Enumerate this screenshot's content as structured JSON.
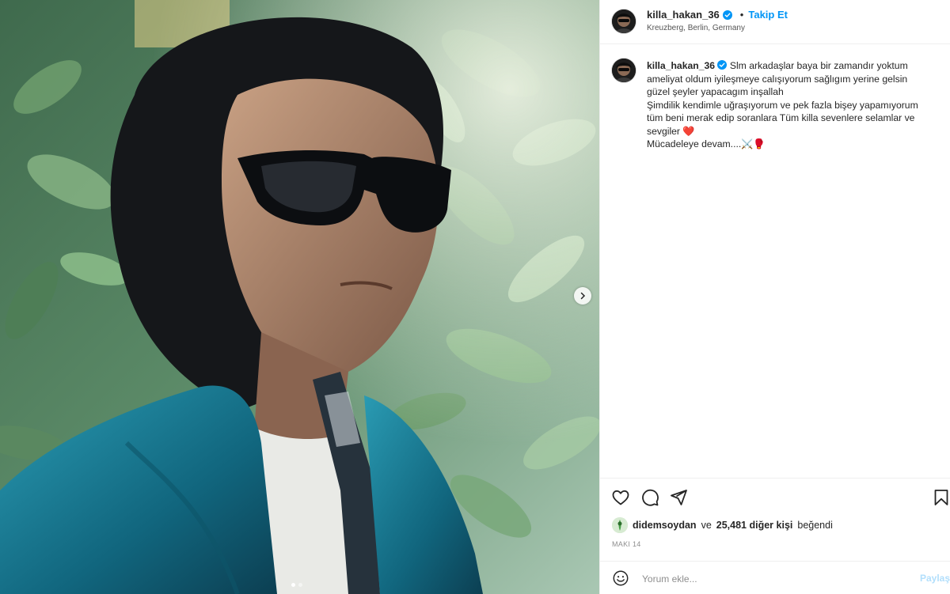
{
  "post": {
    "username": "killa_hakan_36",
    "separator": "•",
    "follow_label": "Takip Et",
    "location": "Kreuzberg, Berlin, Germany",
    "caption_lines": [
      "Slm arkadaşlar baya bir zamandır yoktum",
      "ameliyat oldum iyileşmeye calışıyorum sağlıgım yerine gelsin",
      "güzel şeyler yapacagım inşallah",
      "Şimdilik kendimle uğraşıyorum ve pek fazla bişey yapamıyorum",
      "tüm beni merak edip soranlara Tüm killa sevenlere selamlar ve",
      "sevgiler ❤️",
      "Mücadeleye devam....⚔️🥊"
    ],
    "likes": {
      "first_user": "didemsoydan",
      "connector": "ve",
      "others": "25,481 diğer kişi",
      "suffix": "beğendi"
    },
    "date": "MAKI 14"
  },
  "comment": {
    "placeholder": "Yorum ekle...",
    "share_label": "Paylaş"
  },
  "icons": {
    "like": "heart-icon",
    "comment": "comment-icon",
    "share": "send-icon",
    "save": "bookmark-icon",
    "verified": "verified-badge-icon",
    "next": "chevron-right-icon",
    "emoji": "emoji-icon"
  },
  "carousel": {
    "total_slides": 2,
    "active_slide": 1
  },
  "colors": {
    "accent": "#0095f6",
    "verified": "#0095f6",
    "text": "#262626",
    "muted": "#8e8e8e"
  }
}
